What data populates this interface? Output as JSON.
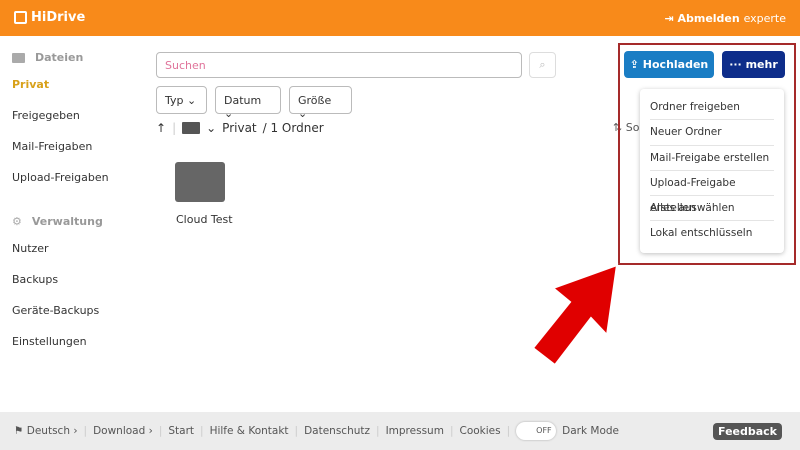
{
  "header": {
    "brand": "HiDrive",
    "logout": "Abmelden",
    "user": "experte"
  },
  "sidebar": {
    "files_heading": "Dateien",
    "files_items": [
      "Privat",
      "Freigegeben",
      "Mail-Freigaben",
      "Upload-Freigaben"
    ],
    "admin_heading": "Verwaltung",
    "admin_items": [
      "Nutzer",
      "Backups",
      "Geräte-Backups",
      "Einstellungen"
    ]
  },
  "search": {
    "placeholder": "Suchen"
  },
  "filters": [
    "Typ",
    "Datum",
    "Größe"
  ],
  "breadcrumb": {
    "folder": "Privat",
    "count": "/ 1 Ordner"
  },
  "sort_label": "Sortieren",
  "files": [
    {
      "name": "Cloud Test"
    }
  ],
  "toolbar": {
    "upload": "Hochladen",
    "more": "mehr"
  },
  "more_menu": [
    "Ordner freigeben",
    "Neuer Ordner",
    "Mail-Freigabe erstellen",
    "Upload-Freigabe erstellen",
    "Alles auswählen",
    "Lokal entschlüsseln"
  ],
  "footer": {
    "language": "Deutsch",
    "download": "Download",
    "links": [
      "Start",
      "Hilfe & Kontakt",
      "Datenschutz",
      "Impressum",
      "Cookies"
    ],
    "toggle": "OFF",
    "dark_mode": "Dark Mode",
    "feedback": "Feedback"
  },
  "colors": {
    "brand": "#f88a1a",
    "upload": "#1a7dc4",
    "more": "#0e2d8a",
    "annotation": "#e00000"
  }
}
